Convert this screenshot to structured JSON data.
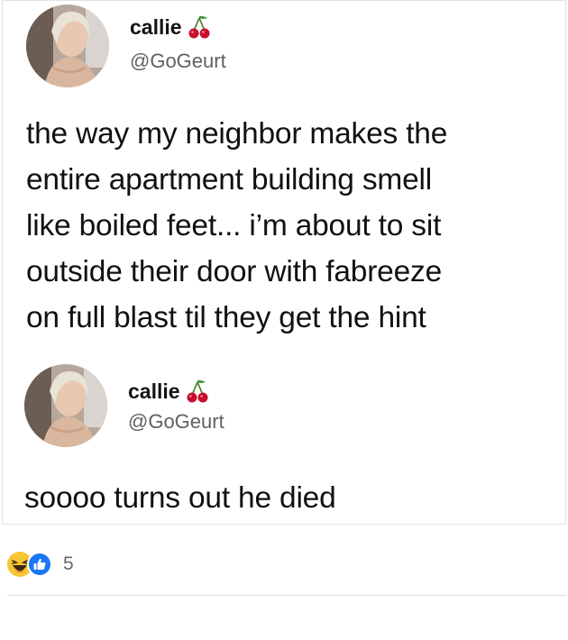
{
  "tweets": [
    {
      "name": "callie",
      "handle": "@GoGeurt",
      "text_lines": [
        "the way my neighbor makes the",
        "entire apartment building smell",
        "like boiled feet... i’m about to sit",
        "outside their door with fabreeze",
        "on full blast til they get the hint"
      ],
      "name_icon": "cherry-icon"
    },
    {
      "name": "callie",
      "handle": "@GoGeurt",
      "text_lines": [
        "soooo turns out he died"
      ],
      "name_icon": "cherry-icon"
    }
  ],
  "reactions": {
    "icons": [
      "haha-icon",
      "like-icon"
    ],
    "count": "5"
  },
  "colors": {
    "like_blue": "#1877f2",
    "haha_yellow": "#f7c634",
    "handle_gray": "#5d6065",
    "count_gray": "#65676b"
  }
}
